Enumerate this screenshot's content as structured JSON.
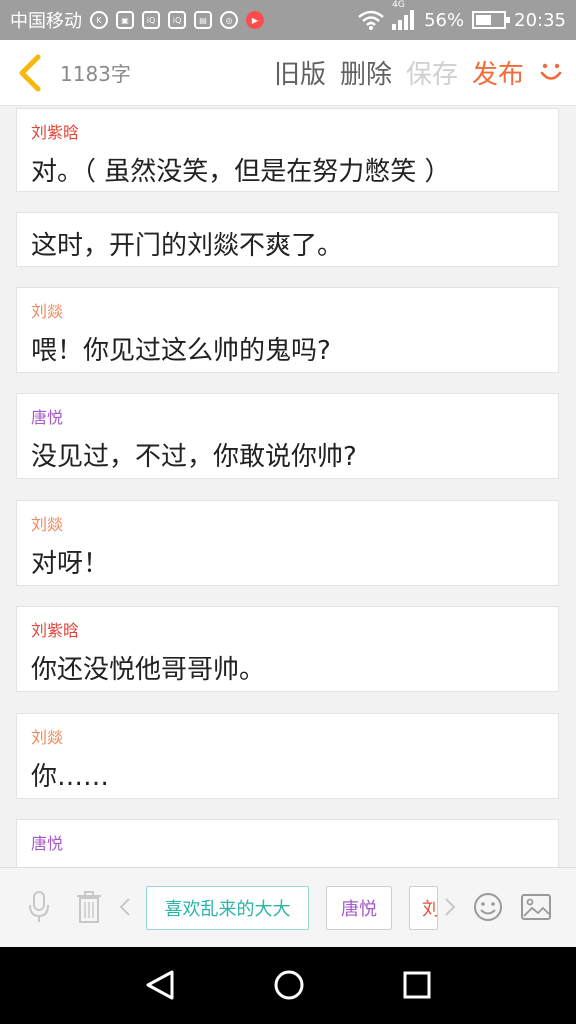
{
  "status_bar": {
    "carrier": "中国移动",
    "network": "4G",
    "battery": "56%",
    "battery_level": 0.56,
    "time": "20:35"
  },
  "header": {
    "word_count": "1183字",
    "old_version": "旧版",
    "delete": "删除",
    "save": "保存",
    "publish": "发布"
  },
  "speaker_colors": {
    "刘紫晗": "#e2463a",
    "刘燚": "#f08a5d",
    "唐悦": "#a65ac8"
  },
  "cards": [
    {
      "speaker": "刘紫晗",
      "text": "对。（ 虽然没笑，但是在努力憋笑 ）"
    },
    {
      "speaker": "",
      "text": "这时，开门的刘燚不爽了。"
    },
    {
      "speaker": "刘燚",
      "text": "喂！你见过这么帅的鬼吗?"
    },
    {
      "speaker": "唐悦",
      "text": "没见过，不过，你敢说你帅?"
    },
    {
      "speaker": "刘燚",
      "text": "对呀！"
    },
    {
      "speaker": "刘紫晗",
      "text": "你还没悦他哥哥帅。"
    },
    {
      "speaker": "刘燚",
      "text": "你……"
    },
    {
      "speaker": "唐悦",
      "text": ""
    }
  ],
  "toolbar": {
    "chips": [
      "喜欢乱来的大大",
      "唐悦",
      "刘"
    ]
  }
}
